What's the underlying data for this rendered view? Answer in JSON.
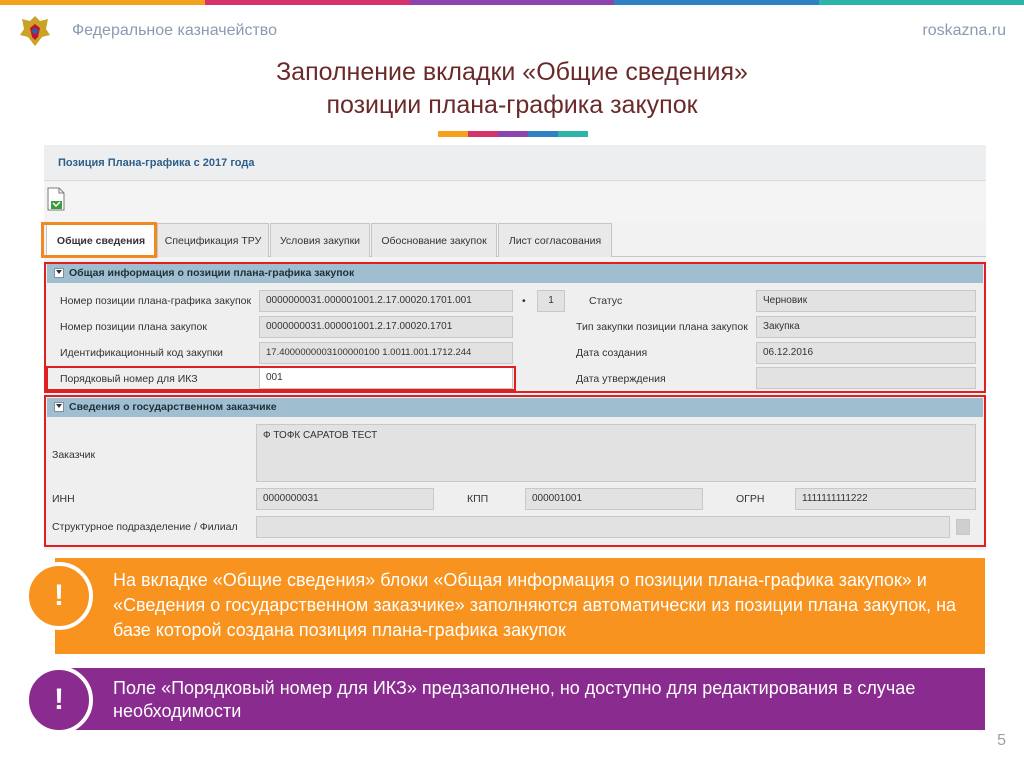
{
  "colors": {
    "stripe": [
      "#f4a21b",
      "#d6336c",
      "#8e44ad",
      "#2f80c4",
      "#2db5a8"
    ],
    "title": "#6b2a2a",
    "orange": "#f7931e",
    "purple": "#8a2b8f",
    "red_frame": "#e02020"
  },
  "header": {
    "org_name": "Федеральное казначейство",
    "site": "roskazna.ru",
    "emblem_icon": "emblem-icon"
  },
  "slide": {
    "title_line1": "Заполнение вкладки «Общие сведения»",
    "title_line2": "позиции плана-графика закупок",
    "page_number": "5"
  },
  "form": {
    "title": "Позиция Плана-графика с 2017 года",
    "toolbar_icon": "document-icon",
    "tabs": [
      {
        "label": "Общие сведения",
        "active": true
      },
      {
        "label": "Спецификация ТРУ",
        "active": false
      },
      {
        "label": "Условия закупки",
        "active": false
      },
      {
        "label": "Обоснование закупок",
        "active": false
      },
      {
        "label": "Лист согласования",
        "active": false
      }
    ],
    "general": {
      "section_title": "Общая информация о позиции плана-графика закупок",
      "plan_schedule_pos_label": "Номер позиции плана-графика закупок",
      "plan_schedule_pos_value": "0000000031.000001001.2.17.00020.1701.001",
      "dot": "•",
      "version_value": "1",
      "plan_pos_label": "Номер позиции плана закупок",
      "plan_pos_value": "0000000031.000001001.2.17.00020.1701",
      "ikz_label": "Идентификационный код закупки",
      "ikz_value": "17.4000000003100000100 1.0011.001.1712.244",
      "ikz_seq_label": "Порядковый номер для ИКЗ",
      "ikz_seq_value": "001",
      "status_label": "Статус",
      "status_value": "Черновик",
      "type_label": "Тип закупки позиции плана закупок",
      "type_value": "Закупка",
      "created_label": "Дата создания",
      "created_value": "06.12.2016",
      "approved_label": "Дата утверждения",
      "approved_value": ""
    },
    "customer": {
      "section_title": "Сведения о государственном заказчике",
      "customer_label": "Заказчик",
      "customer_value": "Ф ТОФК САРАТОВ ТЕСТ",
      "inn_label": "ИНН",
      "inn_value": "0000000031",
      "kpp_label": "КПП",
      "kpp_value": "000001001",
      "ogrn_label": "ОГРН",
      "ogrn_value": "1111111111222",
      "division_label": "Структурное подразделение / Филиал",
      "division_value": ""
    }
  },
  "notes": [
    {
      "mark": "!",
      "text": "На вкладке «Общие сведения» блоки «Общая информация о позиции плана-графика закупок» и «Сведения о государственном заказчике» заполняются автоматически из позиции плана закупок, на базе которой создана позиция плана-графика закупок"
    },
    {
      "mark": "!",
      "text": "Поле «Порядковый номер для ИКЗ» предзаполнено, но доступно для редактирования в случае необходимости"
    }
  ]
}
